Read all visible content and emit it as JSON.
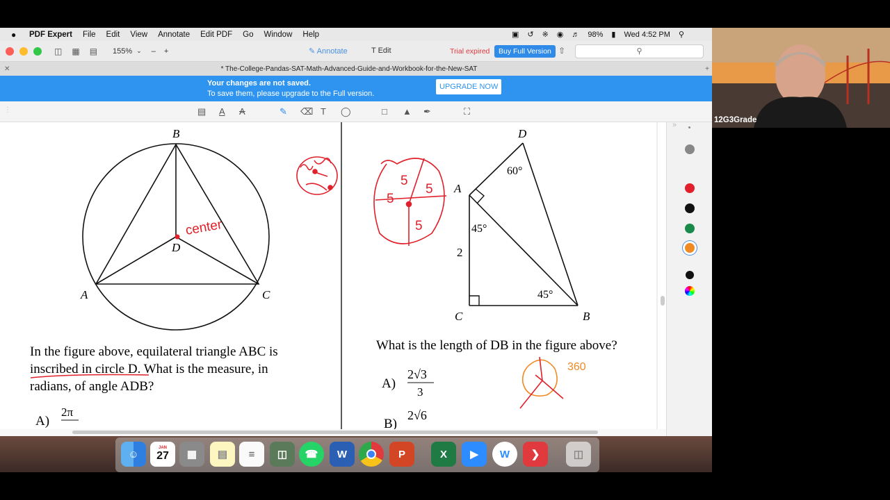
{
  "menubar": {
    "apple": "",
    "app_name": "PDF Expert",
    "items": [
      "File",
      "Edit",
      "View",
      "Annotate",
      "Edit PDF",
      "Go",
      "Window",
      "Help"
    ],
    "battery": "98%",
    "clock": "Wed 4:52 PM"
  },
  "toolbar": {
    "zoom": "155%",
    "annotate_label": "Annotate",
    "edit_label": "Edit",
    "trial_text": "Trial expired",
    "buy_label": "Buy Full Version"
  },
  "tab": {
    "title": "* The-College-Pandas-SAT-Math-Advanced-Guide-and-Workbook-for-the-New-SAT"
  },
  "banner": {
    "line1": "Your changes are not saved.",
    "line2": "To save them, please upgrade to the Full version.",
    "upgrade_label": "UPGRADE NOW"
  },
  "left_problem": {
    "labels": {
      "B": "B",
      "A": "A",
      "C": "C",
      "D": "D"
    },
    "q1": "In the figure above, equilateral triangle ABC is",
    "q2": "inscribed in circle D. What is the measure, in",
    "q3": "radians, of angle ADB?",
    "choice_a_letter": "A)",
    "choice_a_num": "2π",
    "handwriting_center": "center"
  },
  "right_problem": {
    "labels": {
      "D": "D",
      "A": "A",
      "C": "C",
      "B": "B"
    },
    "angle_60": "60°",
    "angle_45a": "45°",
    "angle_45b": "45°",
    "side_2": "2",
    "question": "What is the length of DB in the figure above?",
    "choice_a_letter": "A)",
    "choice_a_num": "2√3",
    "choice_a_den": "3",
    "choice_b_letter": "B)",
    "choice_b_num": "2√6",
    "handwriting_5s": [
      "5",
      "5",
      "5",
      "5"
    ],
    "handwriting_360": "360"
  },
  "colors": {
    "banner": "#2f94f0",
    "ink_red": "#e0202a",
    "ink_orange": "#f08a24",
    "palette": [
      "#888888",
      "#e0202a",
      "#111111",
      "#1a8a4a",
      "#f08a24",
      "#111111"
    ]
  },
  "webcam": {
    "name": "12G3Grade"
  },
  "dock": {
    "apps": [
      "finder-icon",
      "calendar-icon",
      "calculator-icon",
      "notes-icon",
      "reminders-icon",
      "archive-icon",
      "whatsapp-icon",
      "word-icon",
      "chrome-icon",
      "powerpoint-icon",
      "excel-icon",
      "zoom-icon",
      "webex-icon",
      "pdf-expert-icon",
      "trash-icon"
    ],
    "calendar_month": "JAN",
    "calendar_day": "27"
  }
}
